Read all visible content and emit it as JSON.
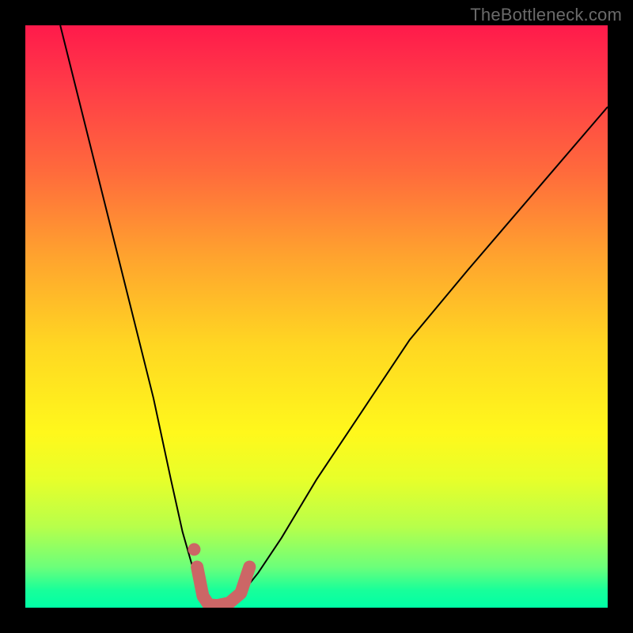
{
  "watermark": "TheBottleneck.com",
  "chart_data": {
    "type": "line",
    "title": "",
    "xlabel": "",
    "ylabel": "",
    "xlim": [
      0,
      100
    ],
    "ylim": [
      0,
      100
    ],
    "grid": false,
    "legend": false,
    "background_gradient": {
      "direction": "vertical",
      "stops": [
        {
          "pos": 0,
          "color": "#ff1a4b"
        },
        {
          "pos": 55,
          "color": "#ffd722"
        },
        {
          "pos": 100,
          "color": "#00ffa6"
        }
      ]
    },
    "series": [
      {
        "name": "bottleneck-curve",
        "color": "#000000",
        "x": [
          6,
          10,
          14,
          18,
          22,
          25,
          27,
          29,
          30.5,
          31.5,
          32.5,
          34,
          36,
          38,
          40,
          44,
          50,
          58,
          66,
          76,
          88,
          100
        ],
        "values": [
          100,
          84,
          68,
          52,
          36,
          22,
          13,
          6,
          2,
          0.5,
          0.3,
          0.5,
          1.5,
          3.5,
          6,
          12,
          22,
          34,
          46,
          58,
          72,
          86
        ]
      }
    ],
    "annotations": [
      {
        "name": "optimal-range-marker",
        "type": "path",
        "color": "#cc6666",
        "description": "Thick salmon U-shaped marker highlighting the minimum region of the curve",
        "x": [
          29.5,
          30.5,
          31.5,
          33,
          35,
          37,
          38.5
        ],
        "values": [
          7,
          2,
          0.5,
          0.4,
          0.8,
          2.5,
          7
        ]
      },
      {
        "name": "optimal-range-dot",
        "type": "point",
        "color": "#cc6666",
        "x": 29,
        "value": 10
      }
    ]
  }
}
